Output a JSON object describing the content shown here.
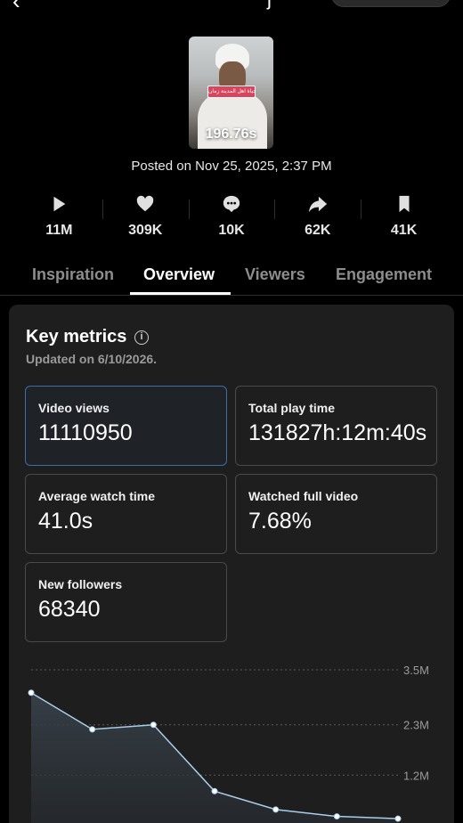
{
  "video": {
    "duration": "196.76s",
    "sticker_text": "حياة اهل المدينة زمان",
    "posted": "Posted on Nov 25, 2025, 2:37 PM"
  },
  "stats": [
    {
      "icon": "play-icon",
      "value": "11M"
    },
    {
      "icon": "heart-icon",
      "value": "309K"
    },
    {
      "icon": "comment-icon",
      "value": "10K"
    },
    {
      "icon": "share-icon",
      "value": "62K"
    },
    {
      "icon": "bookmark-icon",
      "value": "41K"
    }
  ],
  "tabs": [
    {
      "label": "Inspiration",
      "active": false
    },
    {
      "label": "Overview",
      "active": true
    },
    {
      "label": "Viewers",
      "active": false
    },
    {
      "label": "Engagement",
      "active": false
    }
  ],
  "key_metrics": {
    "title": "Key metrics",
    "updated": "Updated on 6/10/2026.",
    "items": [
      {
        "label": "Video views",
        "value": "11110950",
        "selected": true
      },
      {
        "label": "Total play time",
        "value": "131827h:12m:40s",
        "selected": false
      },
      {
        "label": "Average watch time",
        "value": "41.0s",
        "selected": false
      },
      {
        "label": "Watched full video",
        "value": "7.68%",
        "selected": false
      },
      {
        "label": "New followers",
        "value": "68340",
        "selected": false
      }
    ]
  },
  "chart_data": {
    "type": "area",
    "title": "",
    "xlabel": "",
    "ylabel": "",
    "y_ticks": [
      "3.5M",
      "2.3M",
      "1.2M"
    ],
    "ylim": [
      0,
      3.5
    ],
    "y_unit": "M",
    "series": [
      {
        "values": [
          3.0,
          2.2,
          2.3,
          0.85,
          0.45,
          0.3,
          0.25
        ]
      }
    ],
    "grid": true,
    "line_color": "#a9cdea"
  }
}
